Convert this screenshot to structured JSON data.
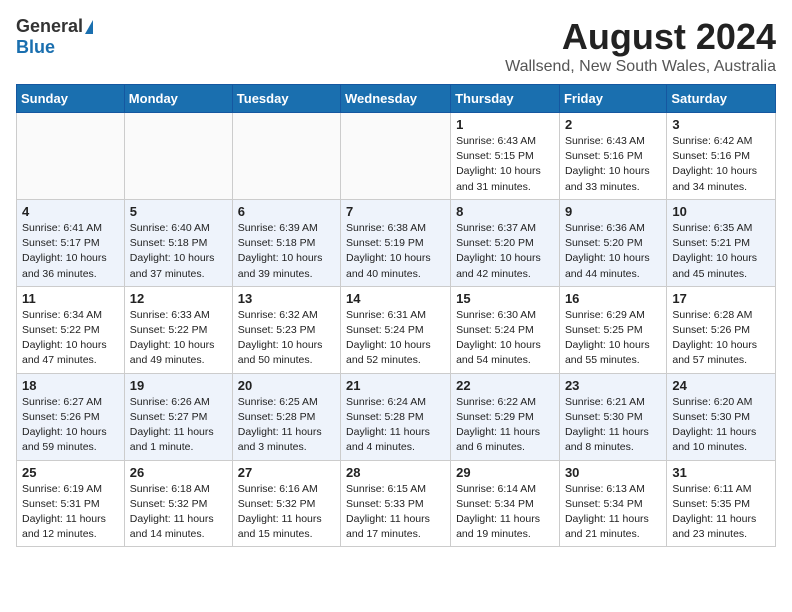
{
  "logo": {
    "general": "General",
    "blue": "Blue"
  },
  "title": "August 2024",
  "location": "Wallsend, New South Wales, Australia",
  "days_of_week": [
    "Sunday",
    "Monday",
    "Tuesday",
    "Wednesday",
    "Thursday",
    "Friday",
    "Saturday"
  ],
  "weeks": [
    [
      {
        "day": "",
        "text": ""
      },
      {
        "day": "",
        "text": ""
      },
      {
        "day": "",
        "text": ""
      },
      {
        "day": "",
        "text": ""
      },
      {
        "day": "1",
        "text": "Sunrise: 6:43 AM\nSunset: 5:15 PM\nDaylight: 10 hours and 31 minutes."
      },
      {
        "day": "2",
        "text": "Sunrise: 6:43 AM\nSunset: 5:16 PM\nDaylight: 10 hours and 33 minutes."
      },
      {
        "day": "3",
        "text": "Sunrise: 6:42 AM\nSunset: 5:16 PM\nDaylight: 10 hours and 34 minutes."
      }
    ],
    [
      {
        "day": "4",
        "text": "Sunrise: 6:41 AM\nSunset: 5:17 PM\nDaylight: 10 hours and 36 minutes."
      },
      {
        "day": "5",
        "text": "Sunrise: 6:40 AM\nSunset: 5:18 PM\nDaylight: 10 hours and 37 minutes."
      },
      {
        "day": "6",
        "text": "Sunrise: 6:39 AM\nSunset: 5:18 PM\nDaylight: 10 hours and 39 minutes."
      },
      {
        "day": "7",
        "text": "Sunrise: 6:38 AM\nSunset: 5:19 PM\nDaylight: 10 hours and 40 minutes."
      },
      {
        "day": "8",
        "text": "Sunrise: 6:37 AM\nSunset: 5:20 PM\nDaylight: 10 hours and 42 minutes."
      },
      {
        "day": "9",
        "text": "Sunrise: 6:36 AM\nSunset: 5:20 PM\nDaylight: 10 hours and 44 minutes."
      },
      {
        "day": "10",
        "text": "Sunrise: 6:35 AM\nSunset: 5:21 PM\nDaylight: 10 hours and 45 minutes."
      }
    ],
    [
      {
        "day": "11",
        "text": "Sunrise: 6:34 AM\nSunset: 5:22 PM\nDaylight: 10 hours and 47 minutes."
      },
      {
        "day": "12",
        "text": "Sunrise: 6:33 AM\nSunset: 5:22 PM\nDaylight: 10 hours and 49 minutes."
      },
      {
        "day": "13",
        "text": "Sunrise: 6:32 AM\nSunset: 5:23 PM\nDaylight: 10 hours and 50 minutes."
      },
      {
        "day": "14",
        "text": "Sunrise: 6:31 AM\nSunset: 5:24 PM\nDaylight: 10 hours and 52 minutes."
      },
      {
        "day": "15",
        "text": "Sunrise: 6:30 AM\nSunset: 5:24 PM\nDaylight: 10 hours and 54 minutes."
      },
      {
        "day": "16",
        "text": "Sunrise: 6:29 AM\nSunset: 5:25 PM\nDaylight: 10 hours and 55 minutes."
      },
      {
        "day": "17",
        "text": "Sunrise: 6:28 AM\nSunset: 5:26 PM\nDaylight: 10 hours and 57 minutes."
      }
    ],
    [
      {
        "day": "18",
        "text": "Sunrise: 6:27 AM\nSunset: 5:26 PM\nDaylight: 10 hours and 59 minutes."
      },
      {
        "day": "19",
        "text": "Sunrise: 6:26 AM\nSunset: 5:27 PM\nDaylight: 11 hours and 1 minute."
      },
      {
        "day": "20",
        "text": "Sunrise: 6:25 AM\nSunset: 5:28 PM\nDaylight: 11 hours and 3 minutes."
      },
      {
        "day": "21",
        "text": "Sunrise: 6:24 AM\nSunset: 5:28 PM\nDaylight: 11 hours and 4 minutes."
      },
      {
        "day": "22",
        "text": "Sunrise: 6:22 AM\nSunset: 5:29 PM\nDaylight: 11 hours and 6 minutes."
      },
      {
        "day": "23",
        "text": "Sunrise: 6:21 AM\nSunset: 5:30 PM\nDaylight: 11 hours and 8 minutes."
      },
      {
        "day": "24",
        "text": "Sunrise: 6:20 AM\nSunset: 5:30 PM\nDaylight: 11 hours and 10 minutes."
      }
    ],
    [
      {
        "day": "25",
        "text": "Sunrise: 6:19 AM\nSunset: 5:31 PM\nDaylight: 11 hours and 12 minutes."
      },
      {
        "day": "26",
        "text": "Sunrise: 6:18 AM\nSunset: 5:32 PM\nDaylight: 11 hours and 14 minutes."
      },
      {
        "day": "27",
        "text": "Sunrise: 6:16 AM\nSunset: 5:32 PM\nDaylight: 11 hours and 15 minutes."
      },
      {
        "day": "28",
        "text": "Sunrise: 6:15 AM\nSunset: 5:33 PM\nDaylight: 11 hours and 17 minutes."
      },
      {
        "day": "29",
        "text": "Sunrise: 6:14 AM\nSunset: 5:34 PM\nDaylight: 11 hours and 19 minutes."
      },
      {
        "day": "30",
        "text": "Sunrise: 6:13 AM\nSunset: 5:34 PM\nDaylight: 11 hours and 21 minutes."
      },
      {
        "day": "31",
        "text": "Sunrise: 6:11 AM\nSunset: 5:35 PM\nDaylight: 11 hours and 23 minutes."
      }
    ]
  ]
}
